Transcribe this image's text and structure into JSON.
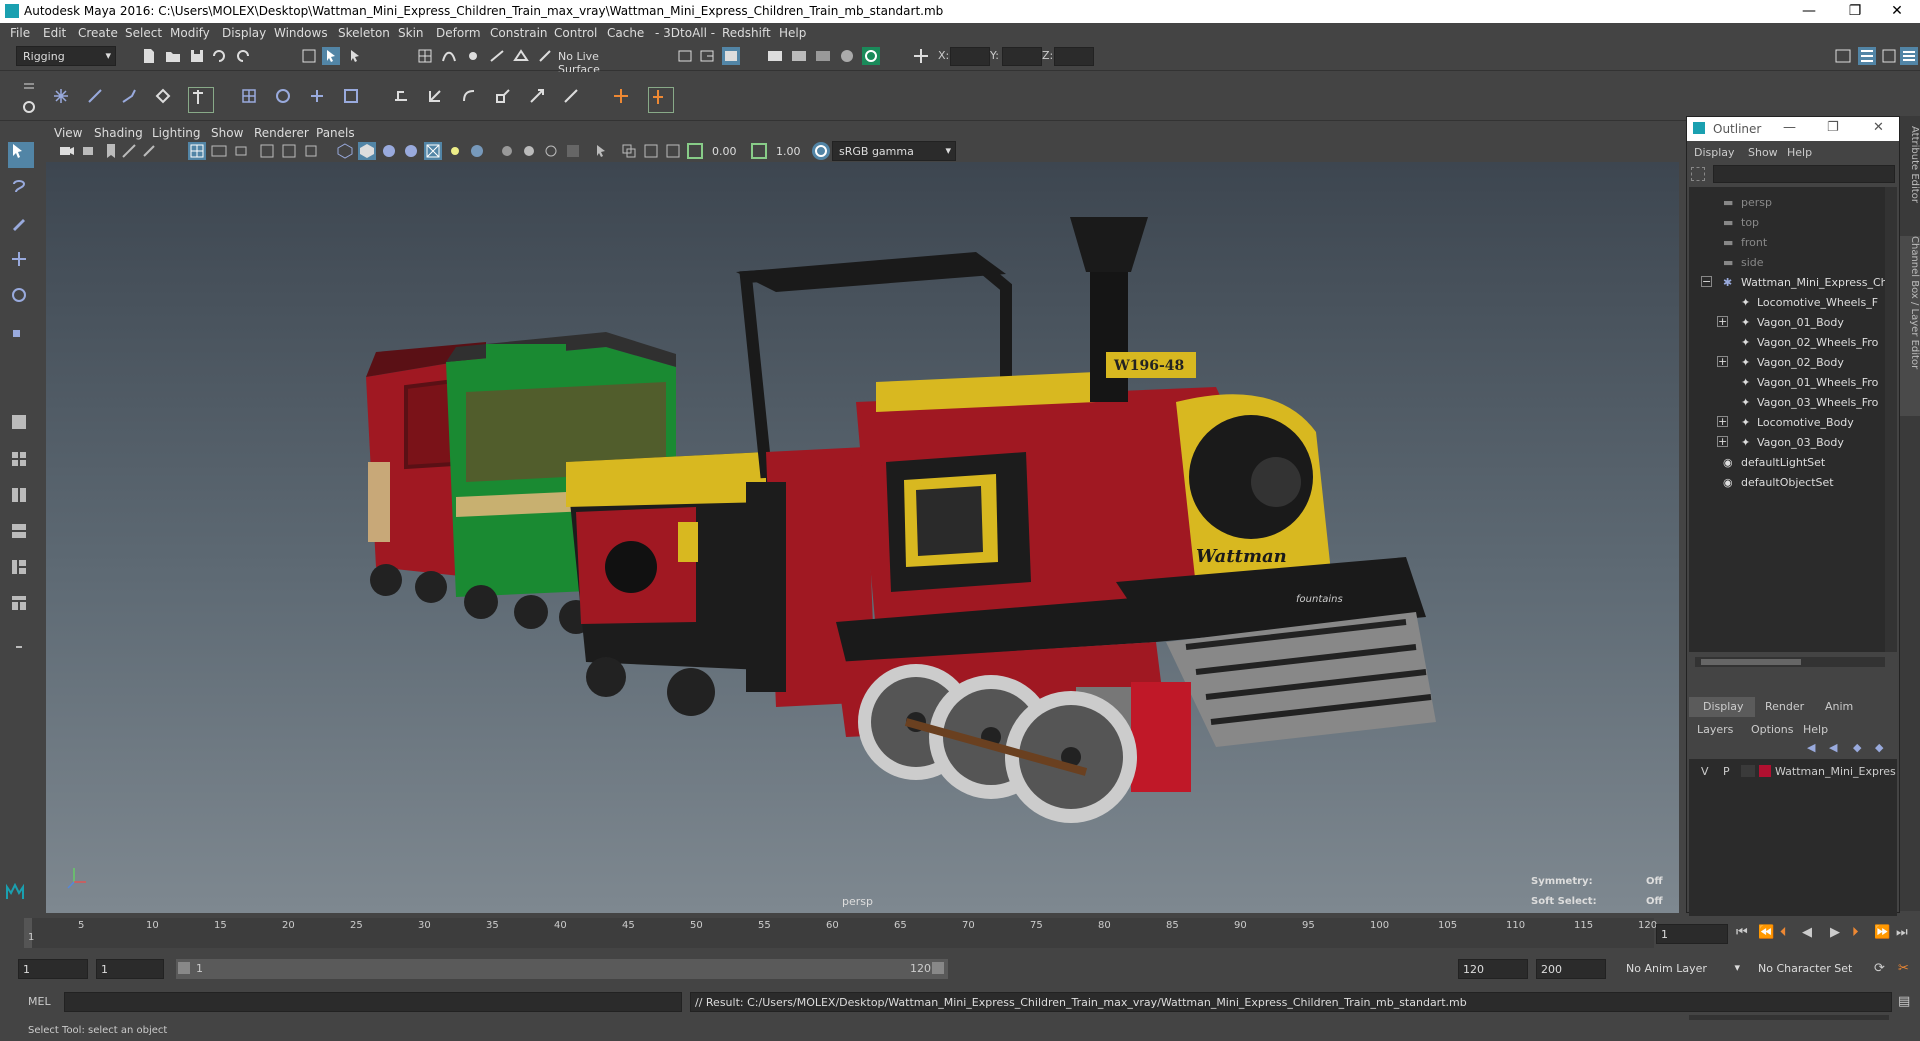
{
  "window": {
    "title": "Autodesk Maya 2016: C:\\Users\\MOLEX\\Desktop\\Wattman_Mini_Express_Children_Train_max_vray\\Wattman_Mini_Express_Children_Train_mb_standart.mb",
    "minimize": "—",
    "restore": "❐",
    "close": "✕"
  },
  "menubar": [
    "File",
    "Edit",
    "Create",
    "Select",
    "Modify",
    "Display",
    "Windows",
    "Skeleton",
    "Skin",
    "Deform",
    "Constrain",
    "Control",
    "Cache",
    "- 3DtoAll -",
    "Redshift",
    "Help"
  ],
  "status": {
    "menuset": "Rigging",
    "live_surface": "No Live Surface",
    "x_label": "X:",
    "y_label": "Y:",
    "z_label": "Z:"
  },
  "viewport": {
    "menu": [
      "View",
      "Shading",
      "Lighting",
      "Show",
      "Renderer",
      "Panels"
    ],
    "exposure": "0.00",
    "gamma": "1.00",
    "color_space": "sRGB gamma",
    "camera_label": "persp",
    "symmetry_label": "Symmetry:",
    "symmetry_value": "Off",
    "soft_select_label": "Soft Select:",
    "soft_select_value": "Off",
    "loco_plate": "W196-48",
    "loco_brand": "Wattman",
    "loco_badge": "fountains"
  },
  "outliner": {
    "title": "Outliner",
    "menu": [
      "Display",
      "Show",
      "Help"
    ],
    "items": [
      {
        "label": "persp",
        "indent": 0,
        "dim": true,
        "type": "camera",
        "expander": ""
      },
      {
        "label": "top",
        "indent": 0,
        "dim": true,
        "type": "camera",
        "expander": ""
      },
      {
        "label": "front",
        "indent": 0,
        "dim": true,
        "type": "camera",
        "expander": ""
      },
      {
        "label": "side",
        "indent": 0,
        "dim": true,
        "type": "camera",
        "expander": ""
      },
      {
        "label": "Wattman_Mini_Express_Ch",
        "indent": 0,
        "dim": false,
        "type": "group",
        "expander": "−"
      },
      {
        "label": "Locomotive_Wheels_F",
        "indent": 1,
        "dim": false,
        "type": "mesh",
        "expander": ""
      },
      {
        "label": "Vagon_01_Body",
        "indent": 1,
        "dim": false,
        "type": "mesh",
        "expander": "+"
      },
      {
        "label": "Vagon_02_Wheels_Fro",
        "indent": 1,
        "dim": false,
        "type": "mesh",
        "expander": ""
      },
      {
        "label": "Vagon_02_Body",
        "indent": 1,
        "dim": false,
        "type": "mesh",
        "expander": "+"
      },
      {
        "label": "Vagon_01_Wheels_Fro",
        "indent": 1,
        "dim": false,
        "type": "mesh",
        "expander": ""
      },
      {
        "label": "Vagon_03_Wheels_Fro",
        "indent": 1,
        "dim": false,
        "type": "mesh",
        "expander": ""
      },
      {
        "label": "Locomotive_Body",
        "indent": 1,
        "dim": false,
        "type": "mesh",
        "expander": "+"
      },
      {
        "label": "Vagon_03_Body",
        "indent": 1,
        "dim": false,
        "type": "mesh",
        "expander": "+"
      },
      {
        "label": "defaultLightSet",
        "indent": 0,
        "dim": false,
        "type": "set",
        "expander": ""
      },
      {
        "label": "defaultObjectSet",
        "indent": 0,
        "dim": false,
        "type": "set",
        "expander": ""
      }
    ]
  },
  "layers": {
    "tabs": [
      "Display",
      "Render",
      "Anim"
    ],
    "menu": [
      "Layers",
      "Options",
      "Help"
    ],
    "layer": {
      "v": "V",
      "p": "P",
      "name": "Wattman_Mini_Expres",
      "color": "#b01030"
    }
  },
  "right_strip": {
    "attr_editor": "Attribute Editor",
    "channel_box": "Channel Box / Layer Editor"
  },
  "timeline": {
    "ticks": [
      "5",
      "10",
      "15",
      "20",
      "25",
      "30",
      "35",
      "40",
      "45",
      "50",
      "55",
      "60",
      "65",
      "70",
      "75",
      "80",
      "85",
      "90",
      "95",
      "100",
      "105",
      "110",
      "115",
      "120"
    ],
    "start_tick": "1",
    "current_frame": "1"
  },
  "range": {
    "start": "1",
    "playback_start": "1",
    "slider_start": "1",
    "slider_end": "120",
    "playback_end": "120",
    "end": "200",
    "anim_layer": "No Anim Layer",
    "char_set": "No Character Set"
  },
  "cmd": {
    "label": "MEL",
    "result": "// Result: C:/Users/MOLEX/Desktop/Wattman_Mini_Express_Children_Train_max_vray/Wattman_Mini_Express_Children_Train_mb_standart.mb"
  },
  "help": {
    "text": "Select Tool: select an object"
  },
  "colors": {
    "accent": "#5285a6",
    "brand": "#1aa0b0"
  }
}
